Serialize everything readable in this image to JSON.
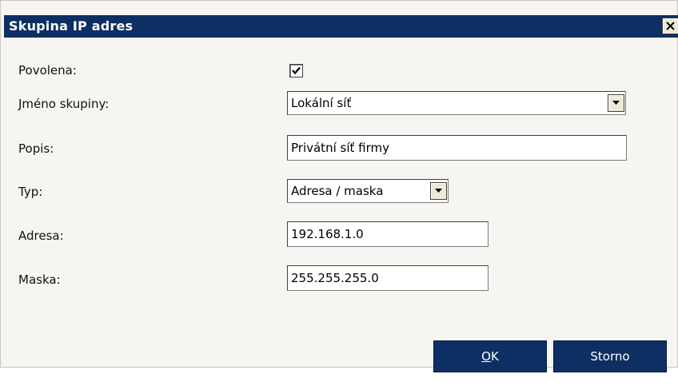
{
  "dialog": {
    "title": "Skupina IP adres",
    "close_icon": "close-icon"
  },
  "form": {
    "enabled_label": "Povolena:",
    "enabled_checked": true,
    "group_name_label": "Jméno skupiny:",
    "group_name_value": "Lokální síť",
    "description_label": "Popis:",
    "description_value": "Privátní síť firmy",
    "type_label": "Typ:",
    "type_value": "Adresa / maska",
    "address_label": "Adresa:",
    "address_value": "192.168.1.0",
    "mask_label": "Maska:",
    "mask_value": "255.255.255.0"
  },
  "buttons": {
    "ok_underlined": "O",
    "ok_rest": "K",
    "cancel": "Storno"
  },
  "colors": {
    "title_bar": "#0e2f63",
    "button_bg": "#0e2f63",
    "dialog_bg": "#f6f5f1"
  }
}
